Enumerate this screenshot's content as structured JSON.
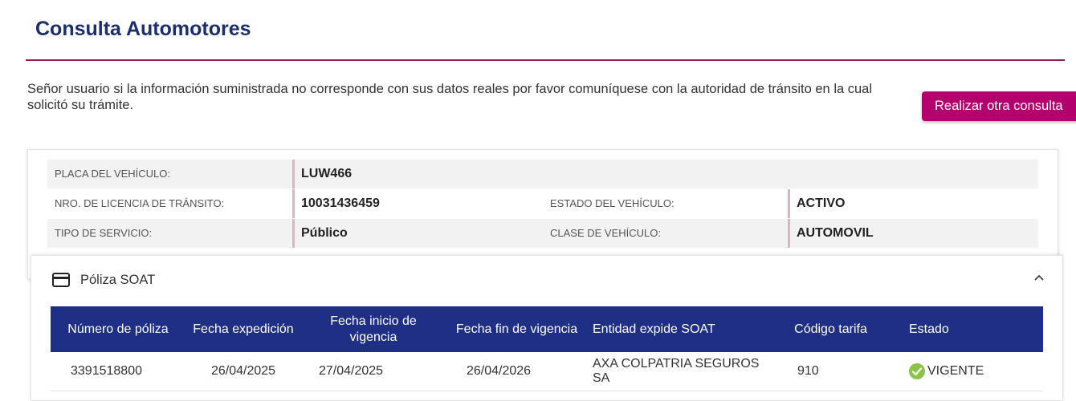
{
  "header": {
    "title": "Consulta Automotores"
  },
  "notice": {
    "text": "Señor usuario si la información suministrada no corresponde con sus datos reales por favor comuníquese con la autoridad de tránsito en la cual solicitó su trámite."
  },
  "actions": {
    "new_query_label": "Realizar otra consulta"
  },
  "vehicle": {
    "plate_label": "PLACA DEL VEHÍCULO:",
    "plate_value": "LUW466",
    "license_label": "NRO. DE LICENCIA DE TRÁNSITO:",
    "license_value": "10031436459",
    "status_label": "ESTADO DEL VEHÍCULO:",
    "status_value": "ACTIVO",
    "service_label": "TIPO DE SERVICIO:",
    "service_value": "Público",
    "class_label": "CLASE DE VEHÍCULO:",
    "class_value": "AUTOMOVIL"
  },
  "soat": {
    "panel_title": "Póliza SOAT",
    "icons": {
      "panel": "credit-card-icon",
      "toggle": "chevron-up-icon",
      "status": "check-circle-icon"
    },
    "colors": {
      "header_bg": "#1f2f86",
      "status_ok": "#8bc34a",
      "accent": "#b3006c"
    },
    "columns": {
      "policy_number": "Número de póliza",
      "issue_date": "Fecha expedición",
      "start_date": "Fecha inicio de vigencia",
      "end_date": "Fecha fin de vigencia",
      "issuer": "Entidad expide SOAT",
      "rate_code": "Código tarifa",
      "status": "Estado"
    },
    "rows": [
      {
        "policy_number": "3391518800",
        "issue_date": "26/04/2025",
        "start_date": "27/04/2025",
        "end_date": "26/04/2026",
        "issuer": "AXA COLPATRIA SEGUROS SA",
        "rate_code": "910",
        "status": "VIGENTE"
      }
    ]
  }
}
